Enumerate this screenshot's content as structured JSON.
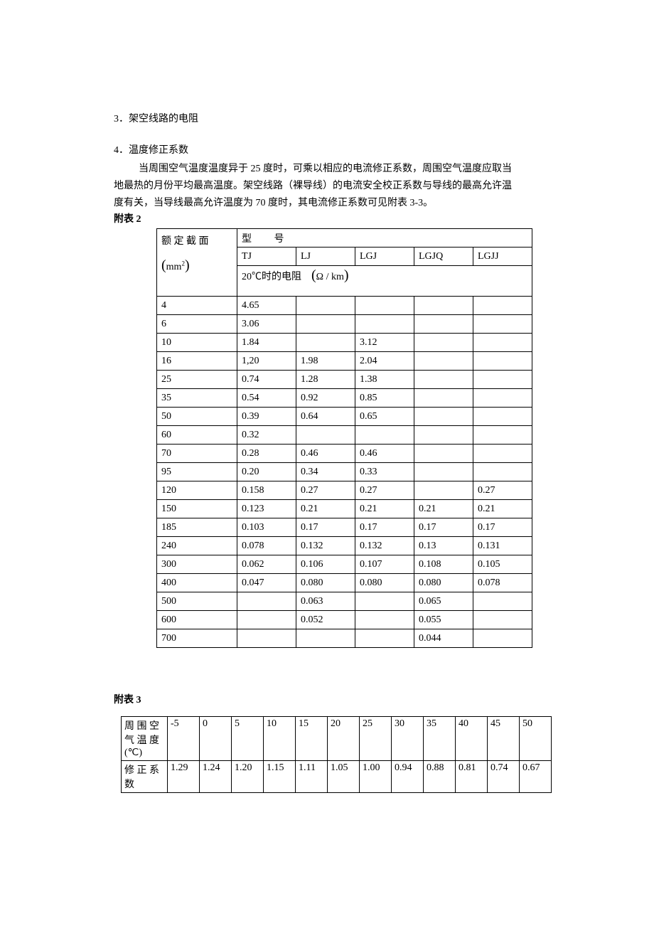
{
  "section3": "3．架空线路的电阻",
  "section4": "4．温度修正系数",
  "para1": "当周围空气温度温度异于 25 度时，可乘以相应的电流修正系数，周围空气温度应取当",
  "para2": "地最热的月份平均最高温度。架空线路（裸导线）的电流安全校正系数与导线的最高允许温",
  "para3": "度有关，当导线最高允许温度为 70 度时，其电流修正系数可见附表 3-3。",
  "t2label": "附表 2",
  "t3label": "附表 3",
  "t2": {
    "corner1a": "额 定 截 面",
    "corner1b_prefix": "mm",
    "corner1b_sup": "2",
    "topheader": "型   号",
    "cols": [
      "TJ",
      "LJ",
      "LGJ",
      "LGJQ",
      "LGJJ"
    ],
    "subheader_prefix": "20℃时的电阻",
    "subheader_unit": "Ω / km",
    "rows": [
      [
        "4",
        "4.65",
        "",
        "",
        "",
        ""
      ],
      [
        "6",
        "3.06",
        "",
        "",
        "",
        ""
      ],
      [
        "10",
        "1.84",
        "",
        "3.12",
        "",
        ""
      ],
      [
        "16",
        "1,20",
        "1.98",
        "2.04",
        "",
        ""
      ],
      [
        "25",
        "0.74",
        "1.28",
        "1.38",
        "",
        ""
      ],
      [
        "35",
        "0.54",
        "0.92",
        "0.85",
        "",
        ""
      ],
      [
        "50",
        "0.39",
        "0.64",
        "0.65",
        "",
        ""
      ],
      [
        "60",
        "0.32",
        "",
        "",
        "",
        ""
      ],
      [
        "70",
        "0.28",
        "0.46",
        "0.46",
        "",
        ""
      ],
      [
        "95",
        "0.20",
        "0.34",
        "0.33",
        "",
        ""
      ],
      [
        "120",
        "0.158",
        "0.27",
        "0.27",
        "",
        "0.27"
      ],
      [
        "150",
        "0.123",
        "0.21",
        "0.21",
        "0.21",
        "0.21"
      ],
      [
        "185",
        "0.103",
        "0.17",
        "0.17",
        "0.17",
        "0.17"
      ],
      [
        "240",
        "0.078",
        "0.132",
        "0.132",
        "0.13",
        "0.131"
      ],
      [
        "300",
        "0.062",
        "0.106",
        "0.107",
        "0.108",
        "0.105"
      ],
      [
        "400",
        "0.047",
        "0.080",
        "0.080",
        "0.080",
        "0.078"
      ],
      [
        "500",
        "",
        "0.063",
        "",
        "0.065",
        ""
      ],
      [
        "600",
        "",
        "0.052",
        "",
        "0.055",
        ""
      ],
      [
        "700",
        "",
        "",
        "",
        "0.044",
        ""
      ]
    ]
  },
  "t3": {
    "row1label_a": "周 围 空",
    "row1label_b": "气 温 度",
    "row1label_c": "(℃)",
    "row2label_a": "修 正 系",
    "row2label_b": "数",
    "temps": [
      "-5",
      "0",
      "5",
      "10",
      "15",
      "20",
      "25",
      "30",
      "35",
      "40",
      "45",
      "50"
    ],
    "coeffs": [
      "1.29",
      "1.24",
      "1.20",
      "1.15",
      "1.11",
      "1.05",
      "1.00",
      "0.94",
      "0.88",
      "0.81",
      "0.74",
      "0.67"
    ]
  }
}
